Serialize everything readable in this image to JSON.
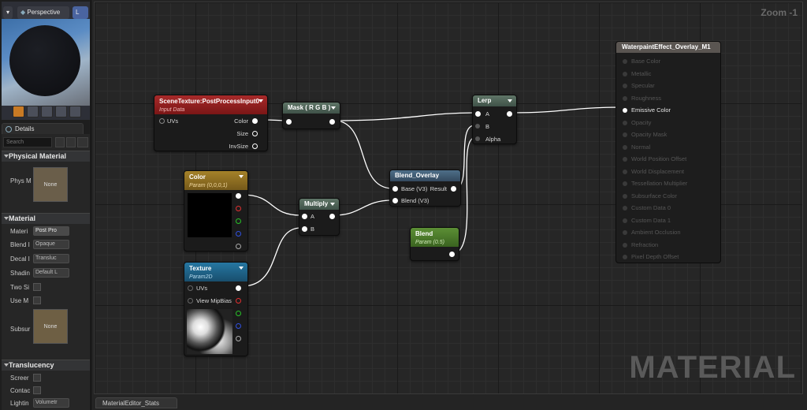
{
  "viewport": {
    "perspective_label": "Perspective",
    "mode_label": "L"
  },
  "details": {
    "tab_label": "Details",
    "search_placeholder": "Search",
    "physical_section": "Physical Material",
    "phys_label": "Phys M",
    "phys_thumb": "None",
    "material_section": "Material",
    "rows": [
      {
        "label": "Materi",
        "value": "Post Pro"
      },
      {
        "label": "Blend I",
        "value": "Opaque"
      },
      {
        "label": "Decal I",
        "value": "Transluc"
      },
      {
        "label": "Shadin",
        "value": "Default L"
      },
      {
        "label": "Two Si",
        "value": ""
      },
      {
        "label": "Use M",
        "value": ""
      },
      {
        "label": "Subsur",
        "value": "None"
      }
    ],
    "translucency_section": "Translucency",
    "trans_rows": [
      {
        "label": "Screer"
      },
      {
        "label": "Contac"
      },
      {
        "label": "Lightin",
        "value": "Volumetr"
      }
    ]
  },
  "graph": {
    "zoom": "Zoom -1",
    "watermark": "MATERIAL"
  },
  "nodes": {
    "scenetex": {
      "title": "SceneTexture:PostProcessInput0",
      "subtitle": "Input Data",
      "in_uvs": "UVs",
      "out_color": "Color",
      "out_size": "Size",
      "out_invsize": "InvSize"
    },
    "mask": {
      "title": "Mask ( R G B )"
    },
    "lerp": {
      "title": "Lerp",
      "a": "A",
      "b": "B",
      "alpha": "Alpha"
    },
    "color": {
      "title": "Color",
      "subtitle": "Param (0,0,0,1)"
    },
    "multiply": {
      "title": "Multiply",
      "a": "A",
      "b": "B"
    },
    "blend_overlay": {
      "title": "Blend_Overlay",
      "base": "Base (V3)",
      "result": "Result",
      "blend": "Blend (V3)"
    },
    "blend": {
      "title": "Blend",
      "subtitle": "Param (0.5)"
    },
    "texture": {
      "title": "Texture",
      "subtitle": "Param2D",
      "uvs": "UVs",
      "mipbias": "View MipBias"
    },
    "output": {
      "title": "WaterpaintEffect_Overlay_M1",
      "pins": [
        "Base Color",
        "Metallic",
        "Specular",
        "Roughness",
        "Emissive Color",
        "Opacity",
        "Opacity Mask",
        "Normal",
        "World Position Offset",
        "World Displacement",
        "Tessellation Multiplier",
        "Subsurface Color",
        "Custom Data 0",
        "Custom Data 1",
        "Ambient Occlusion",
        "Refraction",
        "Pixel Depth Offset"
      ],
      "active_pin": "Emissive Color"
    }
  },
  "bottom_tab": "MaterialEditor_Stats",
  "colors": {
    "scenetex_header": "#8e1e1e",
    "color_header": "#8a6a1c",
    "texture_header": "#1f5f83",
    "blend_header": "#4a7a2a",
    "neutral_header": "#4e5f55",
    "blend_overlay_header": "#3f5d74",
    "output_header": "#5a5551"
  }
}
